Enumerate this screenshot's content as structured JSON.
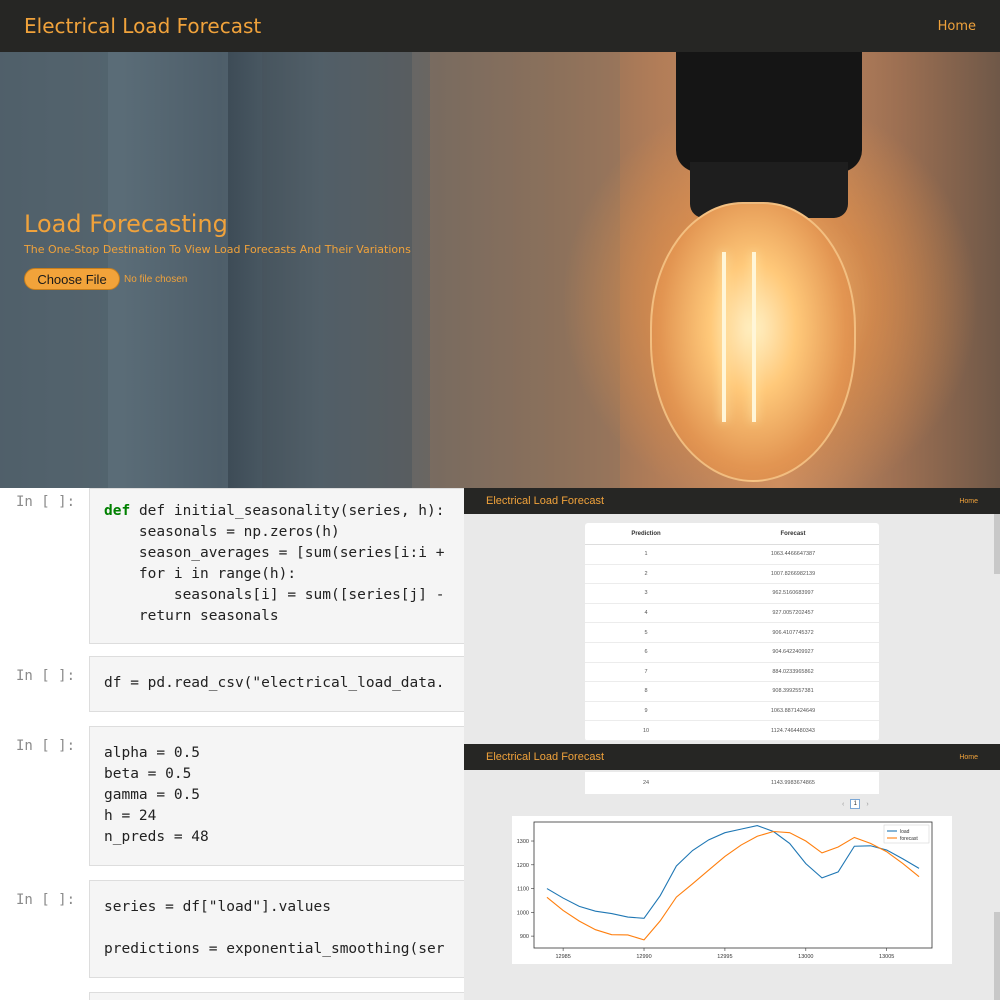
{
  "app": {
    "title": "Electrical Load Forecast",
    "nav_home": "Home",
    "hero_title": "Load Forecasting",
    "hero_subtitle": "The One-Stop Destination To View Load Forecasts And Their Variations",
    "choose_file_label": "Choose File",
    "file_status": "No file chosen"
  },
  "notebook": {
    "prompt": "In [ ]:",
    "cells": [
      {
        "lines": [
          "def initial_seasonality(series, h):",
          "    seasonals = np.zeros(h)",
          "    season_averages = [sum(series[i:i +",
          "    for i in range(h):",
          "        seasonals[i] = sum([series[j] -",
          "    return seasonals"
        ]
      },
      {
        "lines": [
          "df = pd.read_csv(\"electrical_load_data."
        ]
      },
      {
        "lines": [
          "alpha = 0.5",
          "beta = 0.5",
          "gamma = 0.5",
          "h = 24",
          "n_preds = 48"
        ]
      },
      {
        "lines": [
          "series = df[\"load\"].values",
          "",
          "predictions = exponential_smoothing(ser"
        ]
      }
    ]
  },
  "table_view": {
    "title": "Electrical Load Forecast",
    "nav_home": "Home",
    "headers": [
      "Prediction",
      "Forecast"
    ],
    "rows": [
      [
        "1",
        "1063.4466647387"
      ],
      [
        "2",
        "1007.8266982139"
      ],
      [
        "3",
        "962.5160683997"
      ],
      [
        "4",
        "927.0057202457"
      ],
      [
        "5",
        "906.4107745372"
      ],
      [
        "6",
        "904.6422409927"
      ],
      [
        "7",
        "884.0233965862"
      ],
      [
        "8",
        "908.3992557381"
      ],
      [
        "9",
        "1063.8871424649"
      ],
      [
        "10",
        "1124.7464480343"
      ]
    ]
  },
  "chart_view": {
    "title": "Electrical Load Forecast",
    "nav_home": "Home",
    "last_row": [
      "24",
      "1143.9983674865"
    ],
    "pager_prev": "‹",
    "pager_page": "1",
    "pager_next": "›"
  },
  "colors": {
    "accent": "#f0a23b",
    "navbar": "#262624",
    "load_line": "#1f77b4",
    "forecast_line": "#ff7f0e"
  },
  "chart_data": {
    "type": "line",
    "title": "",
    "xlabel": "",
    "ylabel": "",
    "x": [
      12984,
      12985,
      12986,
      12987,
      12988,
      12989,
      12990,
      12991,
      12992,
      12993,
      12994,
      12995,
      12996,
      12997,
      12998,
      12999,
      13000,
      13001,
      13002,
      13003,
      13004,
      13005,
      13006,
      13007
    ],
    "xticks": [
      12985,
      12990,
      12995,
      13000,
      13005
    ],
    "yticks": [
      900,
      1000,
      1100,
      1200,
      1300
    ],
    "xlim": [
      12983.2,
      13007.8
    ],
    "ylim": [
      850,
      1380
    ],
    "grid": false,
    "legend_position": "top-right",
    "series": [
      {
        "name": "load",
        "values": [
          1100,
          1060,
          1025,
          1005,
          995,
          980,
          975,
          1070,
          1195,
          1260,
          1305,
          1335,
          1350,
          1365,
          1340,
          1290,
          1205,
          1145,
          1170,
          1278,
          1280,
          1262,
          1225,
          1185
        ]
      },
      {
        "name": "forecast",
        "values": [
          1063,
          1008,
          963,
          927,
          906,
          905,
          884,
          964,
          1064,
          1120,
          1178,
          1235,
          1283,
          1320,
          1340,
          1335,
          1300,
          1250,
          1275,
          1315,
          1290,
          1255,
          1205,
          1150
        ]
      }
    ]
  }
}
